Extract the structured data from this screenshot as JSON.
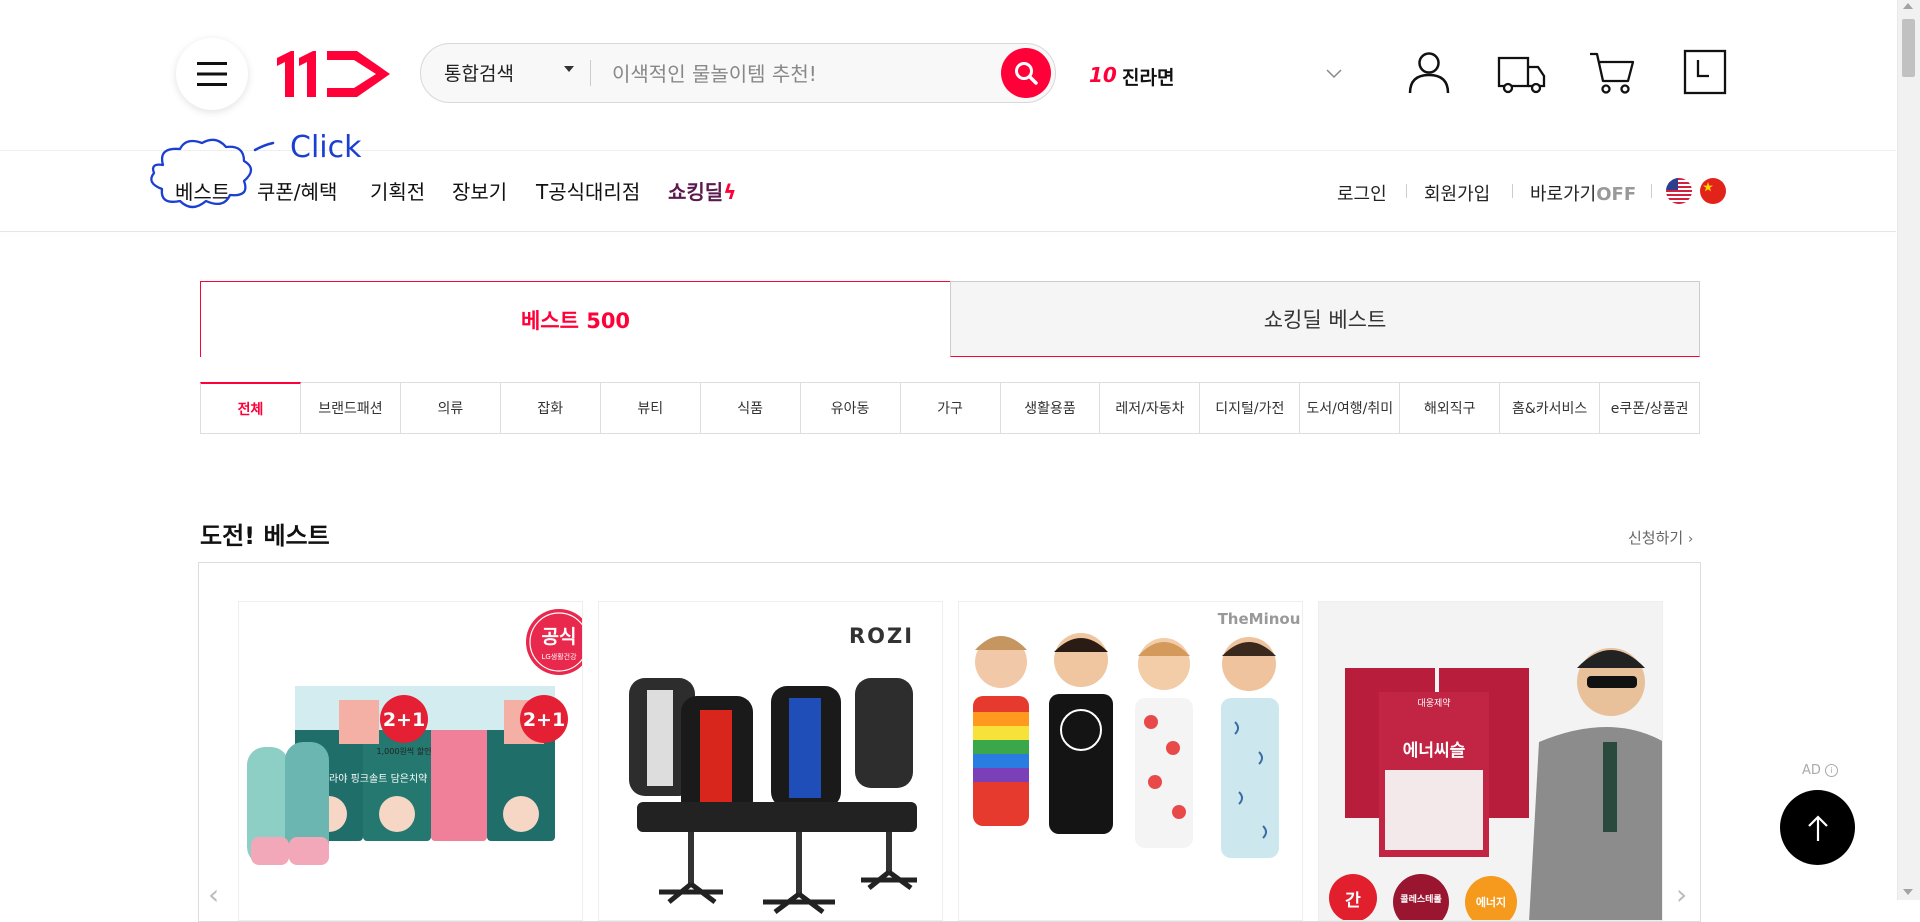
{
  "header": {
    "logo_text": "11",
    "search": {
      "scope": "통합검색",
      "placeholder": "이색적인 물놀이템 추천!"
    },
    "realtime_rank": {
      "number": "10",
      "keyword": "진라면"
    }
  },
  "nav": {
    "items": [
      "베스트",
      "쿠폰/혜택",
      "기획전",
      "장보기",
      "T공식대리점"
    ],
    "shocking_deal": "쇼킹딜",
    "util": {
      "login": "로그인",
      "signup": "회원가입",
      "shortcut": "바로가기",
      "shortcut_state": "OFF"
    }
  },
  "annotation": {
    "text": "Click"
  },
  "best_tabs": {
    "best500": "베스트 500",
    "shocking_best": "쇼킹딜 베스트"
  },
  "categories": [
    "전체",
    "브랜드패션",
    "의류",
    "잡화",
    "뷰티",
    "식품",
    "유아동",
    "가구",
    "생활용품",
    "레저/자동차",
    "디지털/가전",
    "도서/여행/취미",
    "해외직구",
    "홈&카서비스",
    "e쿠폰/상품권"
  ],
  "section": {
    "title": "도전! 베스트",
    "apply": "신청하기",
    "ad_label": "AD"
  },
  "products": [
    {
      "badge": "공식",
      "badge_sub": "LG생활건강",
      "promo": "2+1",
      "promo_sub": "1,000원씩 할인",
      "label": "히말라야 핑크솔트 담은치약"
    },
    {
      "brand": "ROZI"
    },
    {
      "brand": "TheMinou"
    },
    {
      "brand": "대웅제약",
      "label": "에너씨슬",
      "bubbles": [
        "간",
        "콜레스테롤",
        "에너지"
      ]
    }
  ],
  "colors": {
    "accent": "#ff0038",
    "annotation": "#1a3fd1"
  }
}
